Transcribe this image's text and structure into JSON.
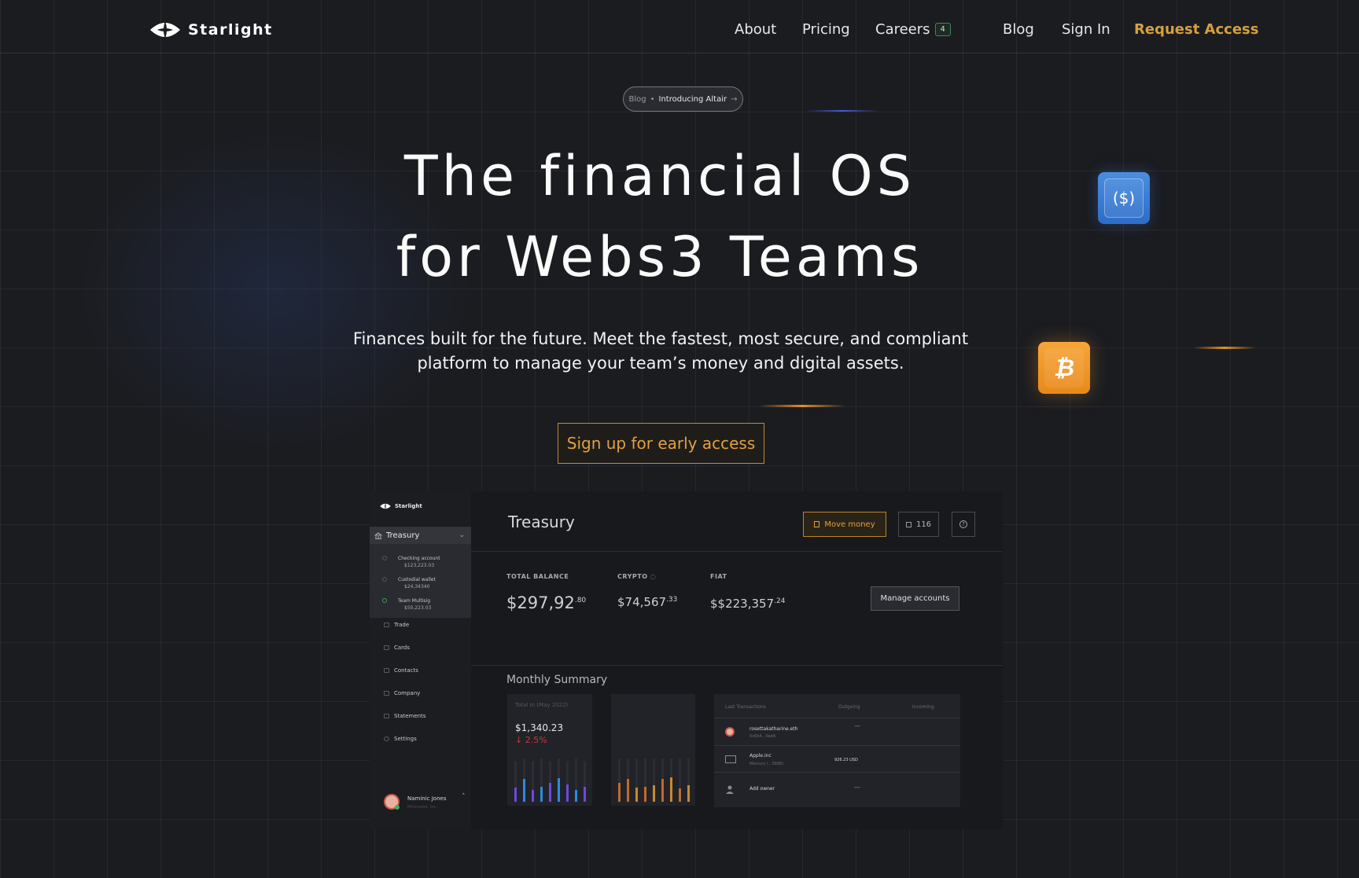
{
  "brand": {
    "name": "Starlight"
  },
  "nav": {
    "links": [
      "About",
      "Pricing",
      "Careers",
      "Blog",
      "Sign In"
    ],
    "careers_badge": "4",
    "request_access": "Request Access"
  },
  "hero": {
    "pill_prefix": "Blog",
    "pill_sep": "•",
    "pill_text": "Introducing Altair",
    "pill_arrow": "→",
    "title_line1": "The financial OS",
    "title_line2": "for Webs3 Teams",
    "subtitle_line1": "Finances built for the future. Meet the fastest, most secure, and compliant",
    "subtitle_line2": "platform to manage your team’s money and digital assets.",
    "cta": "Sign up for early access",
    "usdc_glyph": "($)",
    "btc_glyph": "₿"
  },
  "colors": {
    "accent": "#d4a040",
    "usdc": "#3a7ad8",
    "btc": "#f0962a",
    "background": "#1b1c20"
  },
  "dashboard": {
    "brand": "Starlight",
    "sidebar": {
      "treasury": "Treasury",
      "accounts": [
        {
          "name": "Checking account",
          "value": "$123,223.03"
        },
        {
          "name": "Custodial wallet",
          "value": "$24,34340"
        },
        {
          "name": "Team Multisig",
          "value": "$50,223.03"
        }
      ],
      "items": [
        "Trade",
        "Cards",
        "Contacts",
        "Company",
        "Statements",
        "Settings"
      ],
      "user_name": "Naminic Jones",
      "user_sub": "Minimalist, Inc."
    },
    "title": "Treasury",
    "move_money": "Move money",
    "count": "116",
    "balances": {
      "total_label": "TOTAL BALANCE",
      "total_main": "$297,92",
      "total_sup": ".80",
      "crypto_label": "CRYPTO",
      "crypto_main": "$74,567",
      "crypto_sup": ".33",
      "fiat_label": "FIAT",
      "fiat_main": "$$223,357",
      "fiat_sup": ".24"
    },
    "manage_accounts": "Manage accounts",
    "monthly_summary": "Monthly Summary",
    "card1": {
      "label": "Total In (May 2022)",
      "value": "$1,340.23",
      "change": "↓ 2.5%"
    },
    "transactions": {
      "headers": [
        "Last Transactions",
        "Outgoing",
        "Incoming"
      ],
      "rows": [
        {
          "name": "rosettakatharine.eth",
          "sub": "0x6b4...0ab8",
          "outgoing": "—",
          "icon": "avatar-icon"
        },
        {
          "name": "Apple.inc",
          "sub": "Mercury (...5686)",
          "outgoing": "926.23 USD",
          "icon": "card-icon"
        },
        {
          "name": "Add owner",
          "sub": "",
          "outgoing": "—",
          "icon": "user-icon"
        }
      ]
    }
  }
}
